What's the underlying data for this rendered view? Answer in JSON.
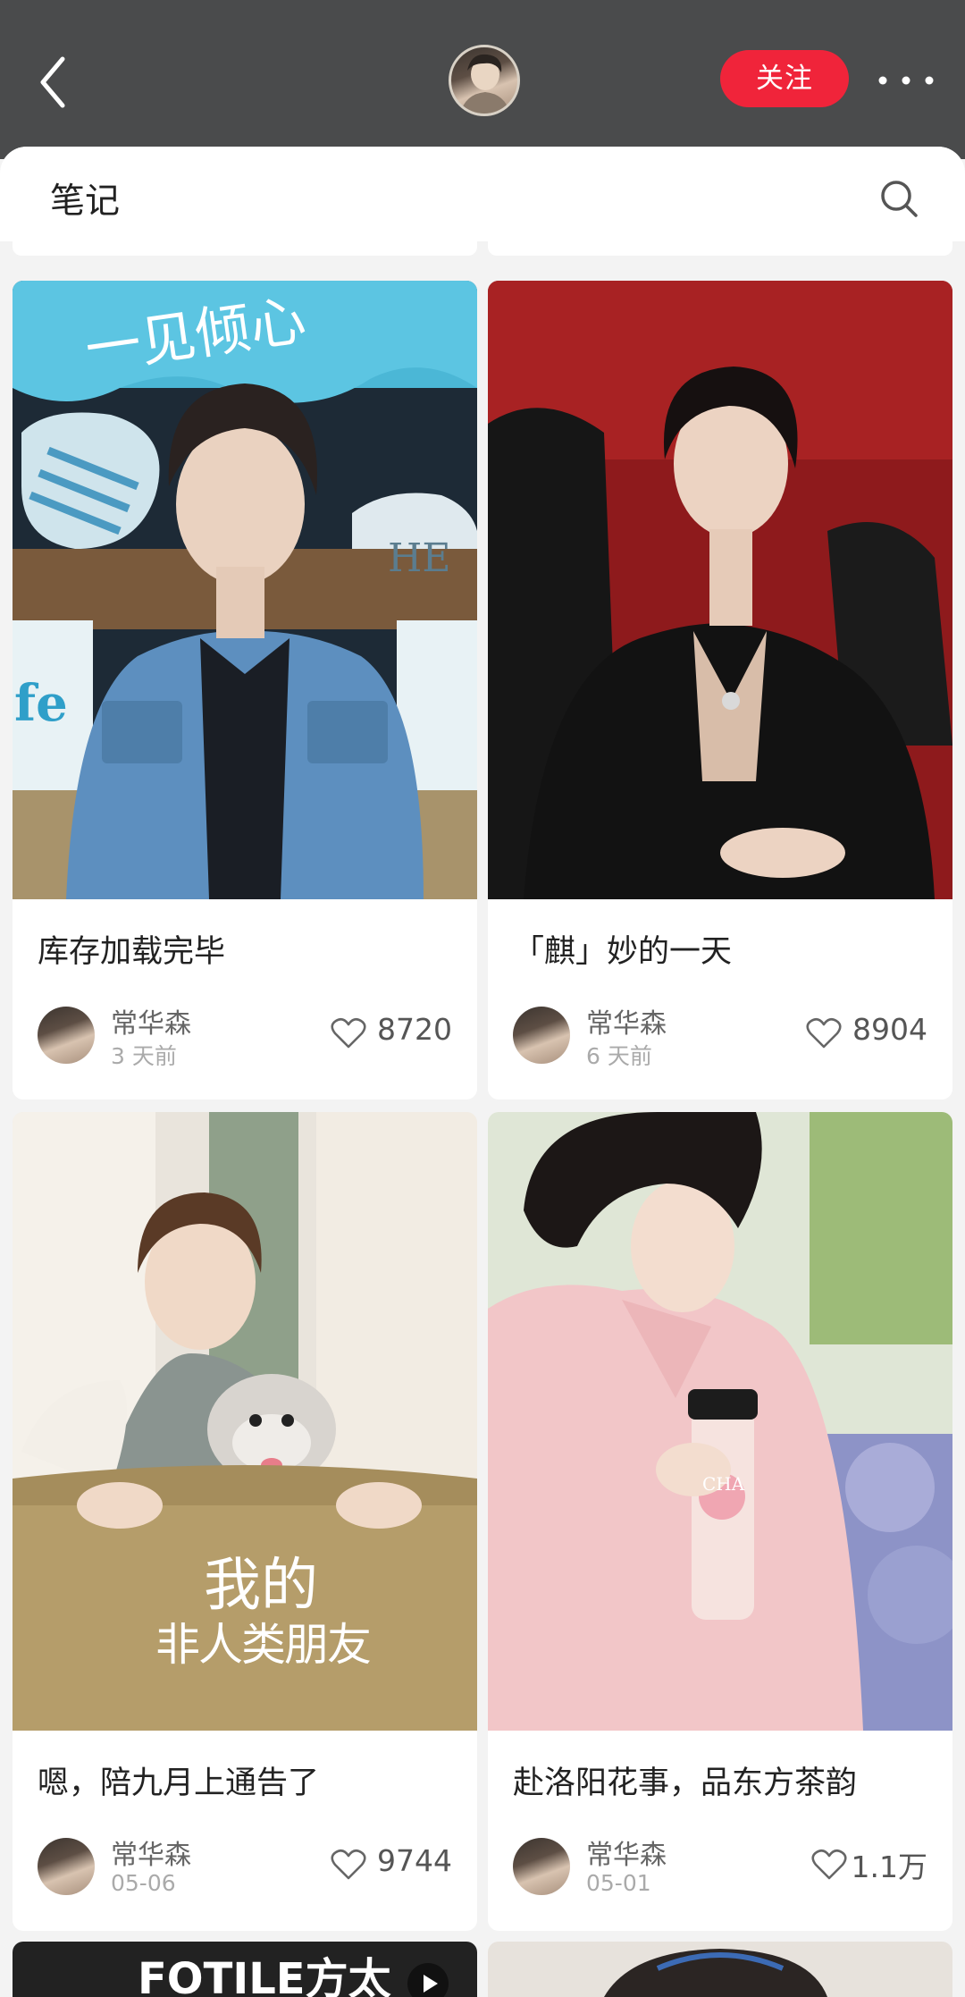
{
  "header": {
    "follow_label": "关注"
  },
  "section": {
    "title": "笔记"
  },
  "notes": [
    {
      "title": "库存加载完毕",
      "author": "常华森",
      "time": "3 天前",
      "likes": "8720",
      "image_text": [
        "一见倾心",
        "HE",
        "fe"
      ]
    },
    {
      "title": "「麒」妙的一天",
      "author": "常华森",
      "time": "6 天前",
      "likes": "8904",
      "image_text": []
    },
    {
      "title": "嗯，陪九月上通告了",
      "author": "常华森",
      "time": "05-06",
      "likes": "9744",
      "image_text": [
        "我的",
        "非人类朋友"
      ]
    },
    {
      "title": "赴洛阳花事，品东方茶韵",
      "author": "常华森",
      "time": "05-01",
      "likes": "1.1万",
      "image_text": [
        "CHA"
      ]
    }
  ],
  "partial_notes": [
    {
      "image_text": "FOTILE方太"
    }
  ],
  "icons": {
    "back": "chevron-left-icon",
    "more": "more-dots-icon",
    "search": "search-icon",
    "like": "heart-outline-icon"
  },
  "colors": {
    "brand_red": "#f0243a",
    "topbar": "#4a4b4c",
    "page_bg": "#f3f3f3"
  }
}
